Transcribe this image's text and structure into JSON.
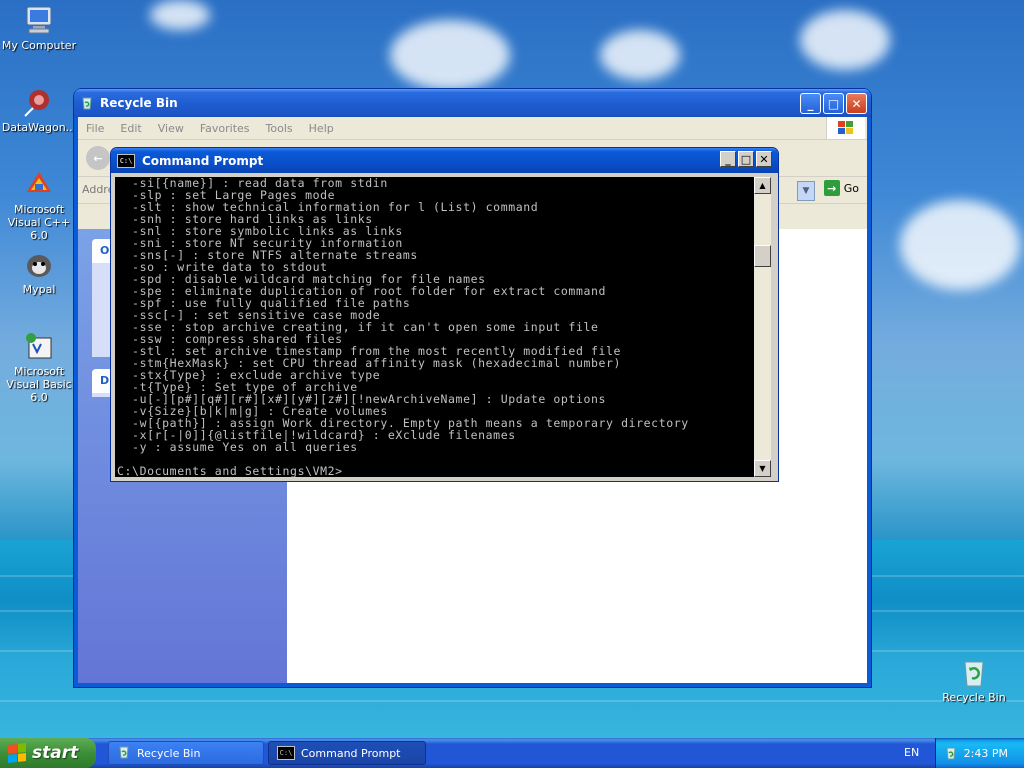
{
  "desktop": {
    "icons": [
      {
        "label": "My Computer",
        "icon": "my-computer-icon"
      },
      {
        "label": "DataWagon...",
        "icon": "datawagon-icon"
      },
      {
        "label": "Microsoft Visual C++ 6.0",
        "icon": "visual-cpp-icon"
      },
      {
        "label": "Mypal",
        "icon": "mypal-browser-icon"
      },
      {
        "label": "Microsoft Visual Basic 6.0",
        "icon": "visual-basic-icon"
      },
      {
        "label": "Recycle Bin",
        "icon": "recycle-bin-icon"
      }
    ]
  },
  "explorer": {
    "title": "Recycle Bin",
    "menu": [
      "File",
      "Edit",
      "View",
      "Favorites",
      "Tools",
      "Help"
    ],
    "address_label": "Addre",
    "go_label": "Go",
    "taskpane_heads": [
      "O",
      "D"
    ]
  },
  "cmd": {
    "title": "Command Prompt",
    "icon_text": "C:\\",
    "lines": [
      "  -si[{name}] : read data from stdin",
      "  -slp : set Large Pages mode",
      "  -slt : show technical information for l (List) command",
      "  -snh : store hard links as links",
      "  -snl : store symbolic links as links",
      "  -sni : store NT security information",
      "  -sns[-] : store NTFS alternate streams",
      "  -so : write data to stdout",
      "  -spd : disable wildcard matching for file names",
      "  -spe : eliminate duplication of root folder for extract command",
      "  -spf : use fully qualified file paths",
      "  -ssc[-] : set sensitive case mode",
      "  -sse : stop archive creating, if it can't open some input file",
      "  -ssw : compress shared files",
      "  -stl : set archive timestamp from the most recently modified file",
      "  -stm{HexMask} : set CPU thread affinity mask (hexadecimal number)",
      "  -stx{Type} : exclude archive type",
      "  -t{Type} : Set type of archive",
      "  -u[-][p#][q#][r#][x#][y#][z#][!newArchiveName] : Update options",
      "  -v{Size}[b|k|m|g] : Create volumes",
      "  -w[{path}] : assign Work directory. Empty path means a temporary directory",
      "  -x[r[-|0]]{@listfile|!wildcard} : eXclude filenames",
      "  -y : assume Yes on all queries",
      "",
      "C:\\Documents and Settings\\VM2>"
    ]
  },
  "taskbar": {
    "start_label": "start",
    "buttons": [
      {
        "label": "Recycle Bin",
        "icon": "recycle-bin-icon"
      },
      {
        "label": "Command Prompt",
        "icon": "command-prompt-icon"
      }
    ],
    "language": "EN",
    "clock": "2:43 PM"
  },
  "colors": {
    "xp_blue": "#0a5bd8",
    "console_bg": "#000000",
    "console_fg": "#c0c0c0",
    "start_green": "#3c8f38"
  }
}
